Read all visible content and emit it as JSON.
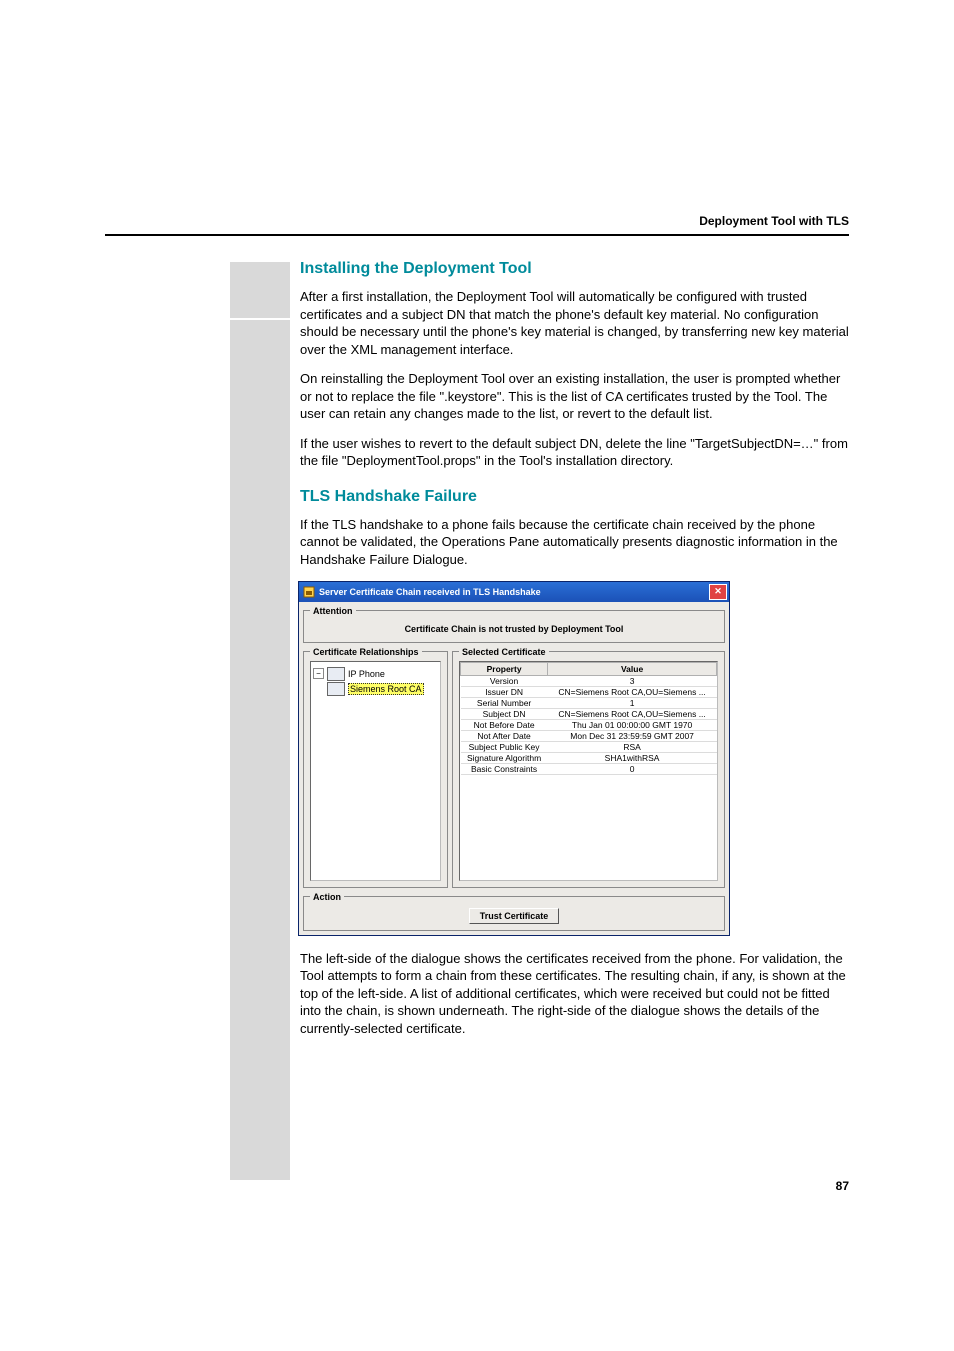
{
  "header": {
    "running_head": "Deployment Tool with TLS"
  },
  "footer": {
    "page_number": "87"
  },
  "sections": {
    "install": {
      "heading": "Installing the Deployment Tool",
      "p1": "After a first installation, the Deployment Tool will automatically be configured with trusted certificates and a subject DN that match the phone's default key material.  No configuration should be necessary until the phone's key material is changed, by transferring new key material over the XML management interface.",
      "p2": "On reinstalling the Deployment Tool over an existing installation, the user is prompted whether or not to replace the file \".keystore\". This is the list of CA certificates trusted by the Tool.  The user can retain any changes made to the list, or revert to the default list.",
      "p3": "If the user wishes to revert to the default subject DN, delete the line \"TargetSubjectDN=…\" from the file \"DeploymentTool.props\" in the Tool's installation directory."
    },
    "tls": {
      "heading": "TLS Handshake Failure",
      "p1": "If the TLS handshake to a phone fails because the certificate chain received by the phone cannot be validated, the Operations Pane automatically presents diagnostic information in the Handshake Failure Dialogue.",
      "p_after": "The left-side of the dialogue shows the certificates received from the phone. For validation, the Tool attempts to form a chain from these certificates. The resulting chain, if any, is shown at the top of the left-side. A list of additional certificates, which were received but could not be fitted into the chain, is shown underneath. The right-side of the dialogue shows the details of the currently-selected certificate."
    }
  },
  "dialog": {
    "title": "Server Certificate Chain received in TLS Handshake",
    "legends": {
      "attention": "Attention",
      "relationships": "Certificate Relationships",
      "selected": "Selected Certificate",
      "action": "Action"
    },
    "attention_msg": "Certificate Chain is not trusted by Deployment Tool",
    "tree": {
      "root": "IP Phone",
      "child": "Siemens Root CA"
    },
    "table": {
      "col_property": "Property",
      "col_value": "Value",
      "rows": [
        {
          "p": "Version",
          "v": "3"
        },
        {
          "p": "Issuer DN",
          "v": "CN=Siemens Root CA,OU=Siemens ..."
        },
        {
          "p": "Serial Number",
          "v": "1"
        },
        {
          "p": "Subject DN",
          "v": "CN=Siemens Root CA,OU=Siemens ..."
        },
        {
          "p": "Not Before Date",
          "v": "Thu Jan 01 00:00:00 GMT 1970"
        },
        {
          "p": "Not After Date",
          "v": "Mon Dec 31 23:59:59 GMT 2007"
        },
        {
          "p": "Subject Public Key",
          "v": "RSA"
        },
        {
          "p": "Signature Algorithm",
          "v": "SHA1withRSA"
        },
        {
          "p": "Basic Constraints",
          "v": "0"
        }
      ]
    },
    "action_button": "Trust Certificate"
  }
}
